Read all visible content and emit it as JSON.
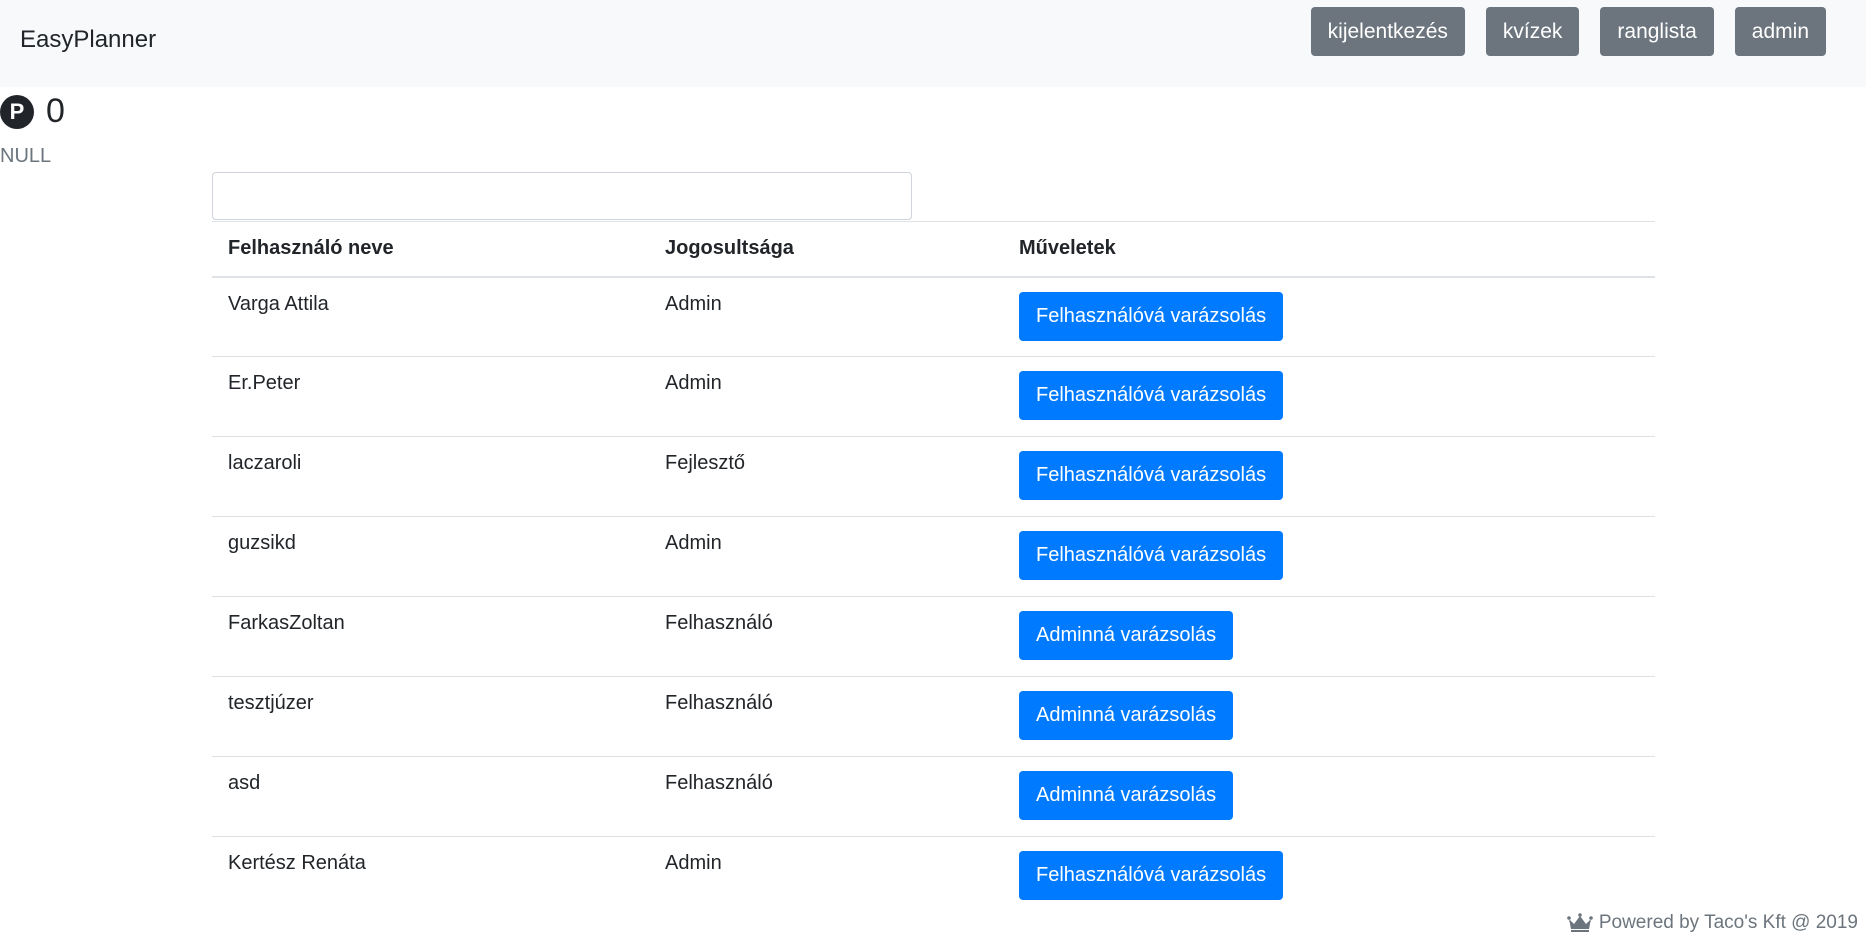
{
  "navbar": {
    "brand": "EasyPlanner",
    "buttons": [
      "kijelentkezés",
      "kvízek",
      "ranglista",
      "admin"
    ]
  },
  "points": {
    "badge": "P",
    "value": "0"
  },
  "status_text": "NULL",
  "search": {
    "value": "",
    "placeholder": ""
  },
  "table": {
    "headers": [
      "Felhasználó neve",
      "Jogosultsága",
      "Műveletek"
    ],
    "rows": [
      {
        "name": "Varga Attila",
        "role": "Admin",
        "action": "Felhasználóvá varázsolás"
      },
      {
        "name": "Er.Peter",
        "role": "Admin",
        "action": "Felhasználóvá varázsolás"
      },
      {
        "name": "laczaroli",
        "role": "Fejlesztő",
        "action": "Felhasználóvá varázsolás"
      },
      {
        "name": "guzsikd",
        "role": "Admin",
        "action": "Felhasználóvá varázsolás"
      },
      {
        "name": "FarkasZoltan",
        "role": "Felhasználó",
        "action": "Adminná varázsolás"
      },
      {
        "name": "tesztjúzer",
        "role": "Felhasználó",
        "action": "Adminná varázsolás"
      },
      {
        "name": "asd",
        "role": "Felhasználó",
        "action": "Adminná varázsolás"
      },
      {
        "name": "Kertész Renáta",
        "role": "Admin",
        "action": "Felhasználóvá varázsolás"
      }
    ]
  },
  "footer": {
    "icon": "crown-icon",
    "text": "Powered by Taco's Kft @ 2019"
  },
  "colors": {
    "navbar_bg": "#f8f9fa",
    "secondary_button": "#6c757d",
    "primary_button": "#007bff"
  }
}
